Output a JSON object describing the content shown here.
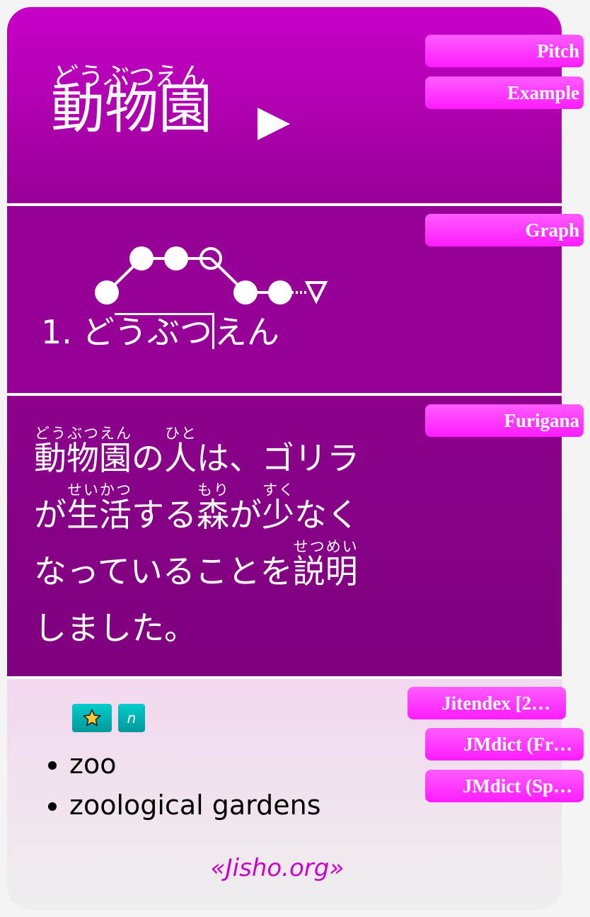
{
  "header": {
    "reading": "どうぶつえん",
    "headword": "動物園",
    "play_icon": "play-triangle-icon",
    "buttons": {
      "pitch": "Pitch",
      "example": "Example"
    }
  },
  "pitch": {
    "button": "Graph",
    "index": "1.",
    "mora": [
      "ど",
      "う",
      "ぶ",
      "つ",
      "え",
      "ん"
    ],
    "high_part": "うぶつ",
    "low_start": "ど",
    "low_end": "えん",
    "pattern": [
      0,
      1,
      1,
      1,
      0,
      0
    ],
    "downstep_mora": 4,
    "particle_pitch": 0,
    "particle_icon": "triangle-down-icon"
  },
  "sentence": {
    "button": "Furigana",
    "segments": [
      {
        "base": "動物園",
        "ruby": "どうぶつえん"
      },
      {
        "text": "の"
      },
      {
        "base": "人",
        "ruby": "ひと"
      },
      {
        "text": "は、ゴリラが"
      },
      {
        "base": "生活",
        "ruby": "せいかつ"
      },
      {
        "text": "する"
      },
      {
        "base": "森",
        "ruby": "もり"
      },
      {
        "text": "が"
      },
      {
        "base": "少",
        "ruby": "すく"
      },
      {
        "text": "なくなっていることを"
      },
      {
        "base": "説明",
        "ruby": "せつめい"
      },
      {
        "text": "しました。"
      }
    ]
  },
  "definitions": {
    "buttons": [
      "Jitendex [2…",
      "JMdict (Fr…",
      "JMdict (Sp…"
    ],
    "tags": [
      {
        "icon": "star-icon",
        "label": "★"
      },
      {
        "label": "n"
      }
    ],
    "items": [
      "zoo",
      "zoological gardens"
    ],
    "source_link": "«Jisho.org»"
  },
  "colors": {
    "header_top": "#c800c8",
    "header_bottom": "#980098",
    "pitch_bg": "#960096",
    "sentence_bg": "#840084",
    "definition_bg": "#f2d8ef",
    "button_pink": "#ff33ff",
    "tag_teal": "#00b3b3",
    "link": "#cc00cc"
  }
}
